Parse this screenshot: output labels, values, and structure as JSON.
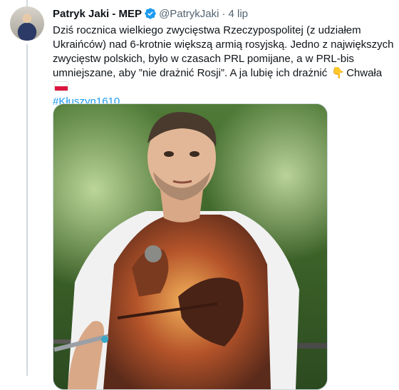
{
  "tweet": {
    "display_name": "Patryk Jaki - MEP",
    "handle": "@PatrykJaki",
    "separator": "·",
    "time": "4 lip",
    "text_main": "Dziś rocznica wielkiego zwycięstwa Rzeczypospolitej (z udziałem Ukraińców) nad 6-krotnie większą armią rosyjską. Jedno z największych zwycięstw polskich, było w czasach PRL pomijane, a w PRL-bis umniejszane, aby ”nie drażnić Rosji”. A ja lubię ich drażnić",
    "text_tail": "Chwała",
    "hashtag": "#Kłuszyn1610",
    "emoji_hand": "👇",
    "emoji_flag_icon": "poland-flag-icon"
  },
  "colors": {
    "link": "#1d9bf0",
    "verified": "#1d9bf0",
    "secondary_text": "#536471"
  }
}
